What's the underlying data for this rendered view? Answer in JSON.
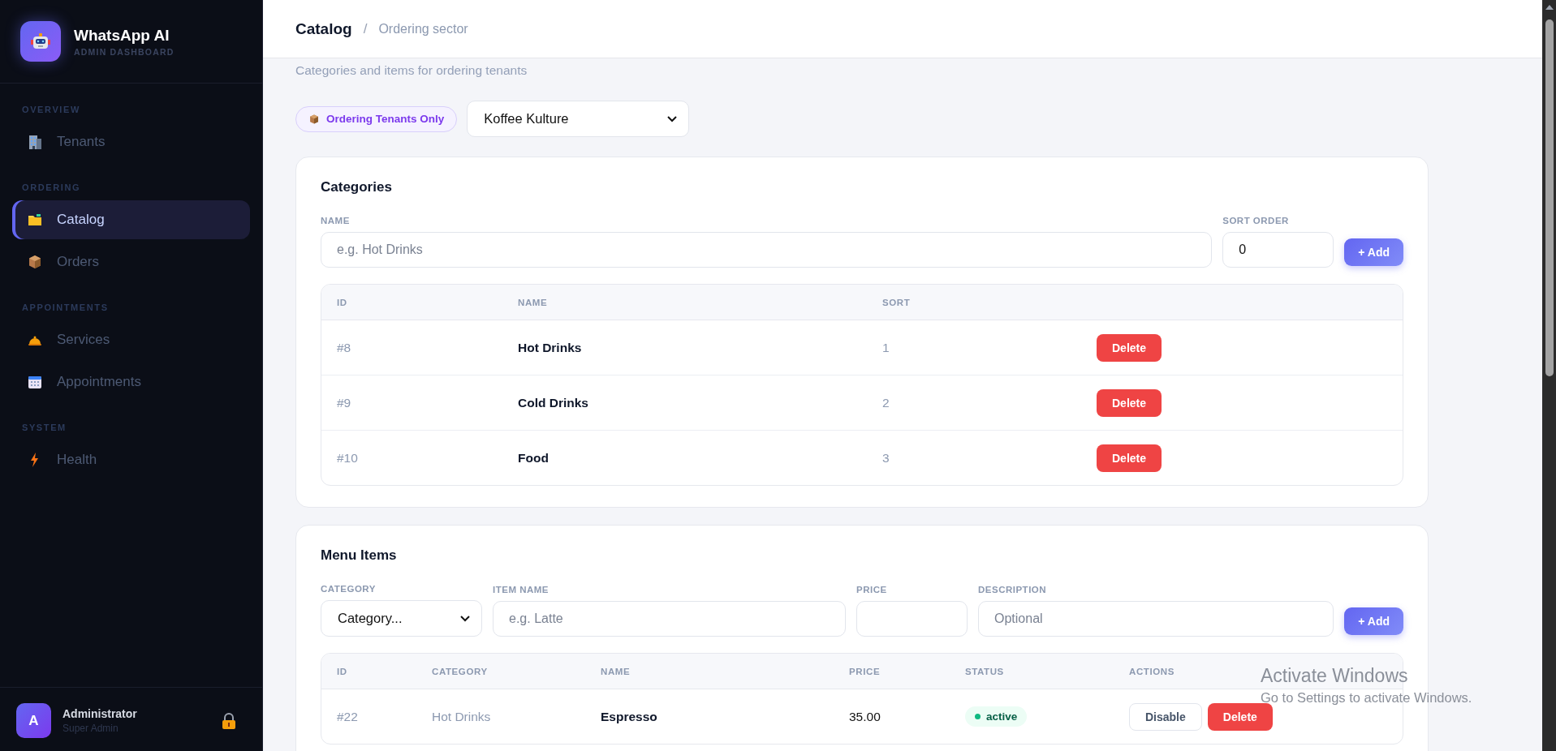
{
  "brand": {
    "name": "WhatsApp AI",
    "tagline": "ADMIN DASHBOARD"
  },
  "nav": [
    {
      "section": "OVERVIEW",
      "items": [
        {
          "label": "Tenants",
          "kind": "building",
          "selected": false
        }
      ]
    },
    {
      "section": "ORDERING",
      "items": [
        {
          "label": "Catalog",
          "kind": "folder",
          "selected": true
        },
        {
          "label": "Orders",
          "kind": "box",
          "selected": false
        }
      ]
    },
    {
      "section": "APPOINTMENTS",
      "items": [
        {
          "label": "Services",
          "kind": "bell",
          "selected": false
        },
        {
          "label": "Appointments",
          "kind": "calendar",
          "selected": false
        }
      ]
    },
    {
      "section": "SYSTEM",
      "items": [
        {
          "label": "Health",
          "kind": "bolt",
          "selected": false
        }
      ]
    }
  ],
  "user": {
    "initial": "A",
    "name": "Administrator",
    "role": "Super Admin"
  },
  "header": {
    "title": "Catalog",
    "separator": "/",
    "subtitle": "Ordering sector"
  },
  "description": "Categories and items for ordering tenants",
  "filter_badge": "Ordering Tenants Only",
  "tenant_select": "Koffee Kulture",
  "categories": {
    "title": "Categories",
    "name_label": "NAME",
    "name_placeholder": "e.g. Hot Drinks",
    "sort_label": "SORT ORDER",
    "sort_value": "0",
    "add": "+ Add",
    "columns": [
      "ID",
      "NAME",
      "SORT"
    ],
    "rows": [
      {
        "id": "#8",
        "name": "Hot Drinks",
        "sort": "1",
        "action": "Delete"
      },
      {
        "id": "#9",
        "name": "Cold Drinks",
        "sort": "2",
        "action": "Delete"
      },
      {
        "id": "#10",
        "name": "Food",
        "sort": "3",
        "action": "Delete"
      }
    ]
  },
  "menu_items": {
    "title": "Menu Items",
    "category_label": "CATEGORY",
    "category_value": "Category...",
    "item_label": "ITEM NAME",
    "item_placeholder": "e.g. Latte",
    "price_label": "PRICE",
    "description_label": "DESCRIPTION",
    "description_placeholder": "Optional",
    "add": "+ Add",
    "columns": [
      "ID",
      "CATEGORY",
      "NAME",
      "PRICE",
      "STATUS",
      "ACTIONS"
    ],
    "rows": [
      {
        "id": "#22",
        "category": "Hot Drinks",
        "name": "Espresso",
        "price": "35.00",
        "status": {
          "label": "active",
          "kind": "active"
        },
        "actions": [
          {
            "label": "Disable",
            "kind": "secondary"
          },
          {
            "label": "Delete",
            "kind": "danger"
          }
        ]
      }
    ]
  },
  "os_notice": {
    "title": "Activate Windows",
    "text": "Go to Settings to activate Windows."
  }
}
